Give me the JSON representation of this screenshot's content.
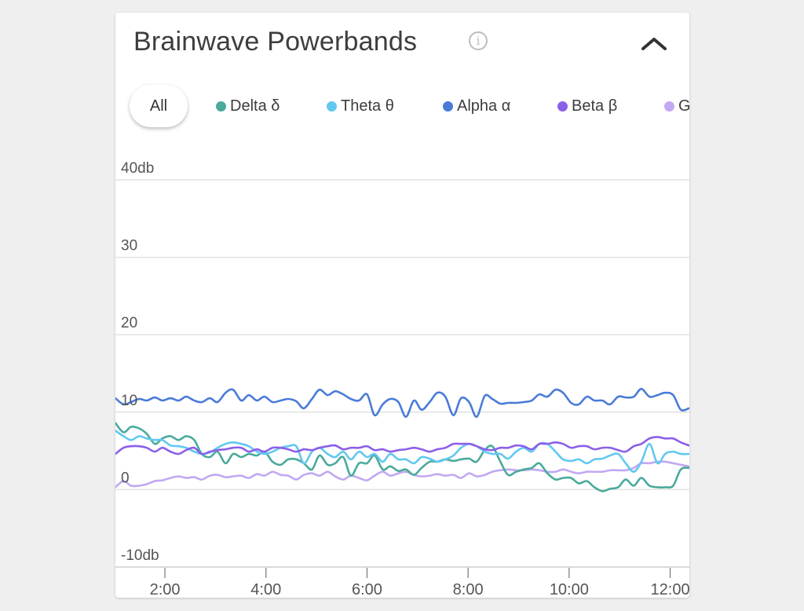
{
  "card": {
    "title": "Brainwave Powerbands",
    "info_icon": "info-icon",
    "collapse_icon": "chevron-up-icon"
  },
  "filters": {
    "all_label": "All",
    "legend": [
      {
        "name": "Delta δ",
        "color": "#4aaa9c"
      },
      {
        "name": "Theta θ",
        "color": "#62c8f0"
      },
      {
        "name": "Alpha α",
        "color": "#4a7bd8"
      },
      {
        "name": "Beta β",
        "color": "#8b5fe8"
      },
      {
        "name": "G",
        "color": "#c2a8f2"
      }
    ]
  },
  "chart_data": {
    "type": "line",
    "title": "Brainwave Powerbands",
    "xlabel": "",
    "ylabel": "db",
    "ylim": [
      -10,
      40
    ],
    "xlim": [
      1.02,
      12.38
    ],
    "grid": true,
    "y_ticks": [
      {
        "value": 40,
        "label": "40db"
      },
      {
        "value": 30,
        "label": "30"
      },
      {
        "value": 20,
        "label": "20"
      },
      {
        "value": 10,
        "label": "10"
      },
      {
        "value": 0,
        "label": "0"
      },
      {
        "value": -10,
        "label": "-10db"
      }
    ],
    "x_ticks": [
      {
        "value": 2,
        "label": "2:00"
      },
      {
        "value": 4,
        "label": "4:00"
      },
      {
        "value": 6,
        "label": "6:00"
      },
      {
        "value": 8,
        "label": "8:00"
      },
      {
        "value": 10,
        "label": "10:00"
      },
      {
        "value": 12,
        "label": "12:00"
      }
    ],
    "x": [
      1.02,
      1.18,
      1.33,
      1.49,
      1.64,
      1.8,
      1.95,
      2.11,
      2.27,
      2.42,
      2.58,
      2.73,
      2.89,
      3.04,
      3.2,
      3.35,
      3.51,
      3.66,
      3.82,
      3.97,
      4.13,
      4.29,
      4.44,
      4.6,
      4.75,
      4.91,
      5.06,
      5.22,
      5.37,
      5.53,
      5.68,
      5.84,
      6.0,
      6.15,
      6.31,
      6.46,
      6.62,
      6.77,
      6.93,
      7.08,
      7.24,
      7.39,
      7.55,
      7.71,
      7.86,
      8.02,
      8.17,
      8.33,
      8.48,
      8.64,
      8.79,
      8.95,
      9.1,
      9.26,
      9.41,
      9.57,
      9.73,
      9.88,
      10.04,
      10.19,
      10.35,
      10.5,
      10.66,
      10.81,
      10.97,
      11.12,
      11.28,
      11.43,
      11.59,
      11.75,
      11.9,
      12.06,
      12.21,
      12.37
    ],
    "series": [
      {
        "name": "Delta δ",
        "color": "#4aaa9c",
        "values": [
          8.6,
          7.4,
          8.1,
          7.9,
          7.2,
          5.9,
          6.6,
          6.9,
          6.4,
          6.9,
          6.4,
          4.6,
          4.2,
          4.9,
          3.4,
          4.6,
          4.2,
          4.6,
          4.4,
          4.9,
          3.6,
          3.2,
          3.9,
          3.9,
          3.4,
          2.6,
          4.4,
          3.2,
          3.4,
          4.2,
          1.8,
          3.4,
          3.4,
          4.4,
          2.6,
          3.0,
          2.4,
          2.6,
          1.9,
          2.8,
          3.6,
          3.6,
          3.9,
          3.7,
          3.9,
          4.0,
          3.6,
          5.1,
          5.6,
          3.6,
          1.9,
          2.3,
          2.6,
          2.8,
          3.4,
          2.1,
          1.3,
          1.5,
          1.5,
          0.8,
          1.1,
          0.3,
          -0.2,
          0.1,
          0.3,
          1.3,
          0.5,
          1.5,
          0.5,
          0.3,
          0.3,
          0.5,
          2.6,
          2.8
        ]
      },
      {
        "name": "Theta θ",
        "color": "#62c8f0",
        "values": [
          7.6,
          6.9,
          6.4,
          6.9,
          6.6,
          6.4,
          6.4,
          5.7,
          5.6,
          5.4,
          4.9,
          4.6,
          4.8,
          5.4,
          5.9,
          6.1,
          5.9,
          5.6,
          4.9,
          4.6,
          4.9,
          5.4,
          5.6,
          5.6,
          3.4,
          4.9,
          5.4,
          4.6,
          4.2,
          4.9,
          3.9,
          4.9,
          4.2,
          4.6,
          3.6,
          4.6,
          3.9,
          3.9,
          3.4,
          4.2,
          4.0,
          3.6,
          3.9,
          4.4,
          5.4,
          5.9,
          5.6,
          4.9,
          4.6,
          4.6,
          4.0,
          4.9,
          5.4,
          4.9,
          5.9,
          5.9,
          4.9,
          3.9,
          3.7,
          3.9,
          3.4,
          3.9,
          4.0,
          4.4,
          4.6,
          3.4,
          2.3,
          3.6,
          5.9,
          3.4,
          4.6,
          4.9,
          4.6,
          4.6
        ]
      },
      {
        "name": "Alpha α",
        "color": "#4a7bd8",
        "values": [
          11.8,
          11.0,
          11.3,
          11.7,
          11.5,
          11.9,
          11.5,
          11.8,
          11.5,
          12.0,
          11.5,
          11.3,
          11.8,
          11.3,
          12.5,
          12.9,
          11.5,
          12.2,
          11.5,
          12.0,
          11.3,
          11.5,
          11.7,
          11.4,
          10.5,
          11.7,
          12.9,
          12.2,
          12.7,
          12.3,
          11.7,
          11.5,
          12.3,
          9.6,
          11.0,
          11.7,
          11.3,
          9.4,
          11.5,
          10.3,
          11.3,
          12.5,
          12.0,
          9.6,
          11.8,
          11.3,
          9.4,
          12.1,
          11.7,
          11.1,
          11.2,
          11.2,
          11.3,
          11.5,
          12.3,
          12.0,
          12.9,
          12.5,
          11.2,
          11.0,
          12.0,
          11.5,
          11.5,
          11.0,
          12.0,
          11.9,
          12.0,
          13.0,
          12.0,
          12.2,
          12.5,
          12.2,
          10.3,
          10.5
        ]
      },
      {
        "name": "Beta β",
        "color": "#8b5fe8",
        "values": [
          4.6,
          5.4,
          5.6,
          5.6,
          5.4,
          4.9,
          5.4,
          4.9,
          4.6,
          5.1,
          5.4,
          4.6,
          4.9,
          5.1,
          5.2,
          5.4,
          5.4,
          4.9,
          5.2,
          4.9,
          5.4,
          5.4,
          5.2,
          4.9,
          5.2,
          5.1,
          5.4,
          5.6,
          5.7,
          5.2,
          5.4,
          5.4,
          5.6,
          5.1,
          5.2,
          4.9,
          5.1,
          5.2,
          5.4,
          5.2,
          4.9,
          5.2,
          5.4,
          5.9,
          5.9,
          5.9,
          5.6,
          5.2,
          5.1,
          5.4,
          5.4,
          5.7,
          5.6,
          5.2,
          5.9,
          5.9,
          6.1,
          5.9,
          5.4,
          5.6,
          5.6,
          5.2,
          5.4,
          5.4,
          5.1,
          4.9,
          5.6,
          5.9,
          6.6,
          6.8,
          6.6,
          6.6,
          6.1,
          5.7
        ]
      },
      {
        "name": "G",
        "color": "#c2a8f2",
        "values": [
          0.3,
          1.1,
          0.5,
          0.5,
          0.7,
          1.1,
          1.2,
          1.5,
          1.7,
          1.5,
          1.6,
          1.3,
          1.8,
          1.9,
          1.6,
          1.7,
          1.8,
          1.5,
          2.0,
          1.8,
          2.3,
          1.9,
          1.8,
          1.3,
          1.9,
          2.1,
          1.8,
          2.3,
          1.7,
          1.3,
          1.8,
          1.5,
          1.2,
          1.8,
          2.3,
          1.8,
          2.1,
          2.3,
          1.9,
          1.7,
          1.8,
          2.0,
          1.8,
          1.9,
          1.5,
          2.1,
          1.7,
          1.9,
          2.3,
          2.5,
          2.6,
          2.5,
          2.5,
          2.6,
          2.5,
          2.3,
          2.3,
          2.6,
          2.3,
          2.1,
          2.3,
          2.3,
          2.3,
          2.5,
          2.5,
          2.5,
          2.8,
          3.4,
          3.4,
          3.6,
          3.6,
          3.4,
          3.2,
          3.0
        ]
      }
    ]
  }
}
